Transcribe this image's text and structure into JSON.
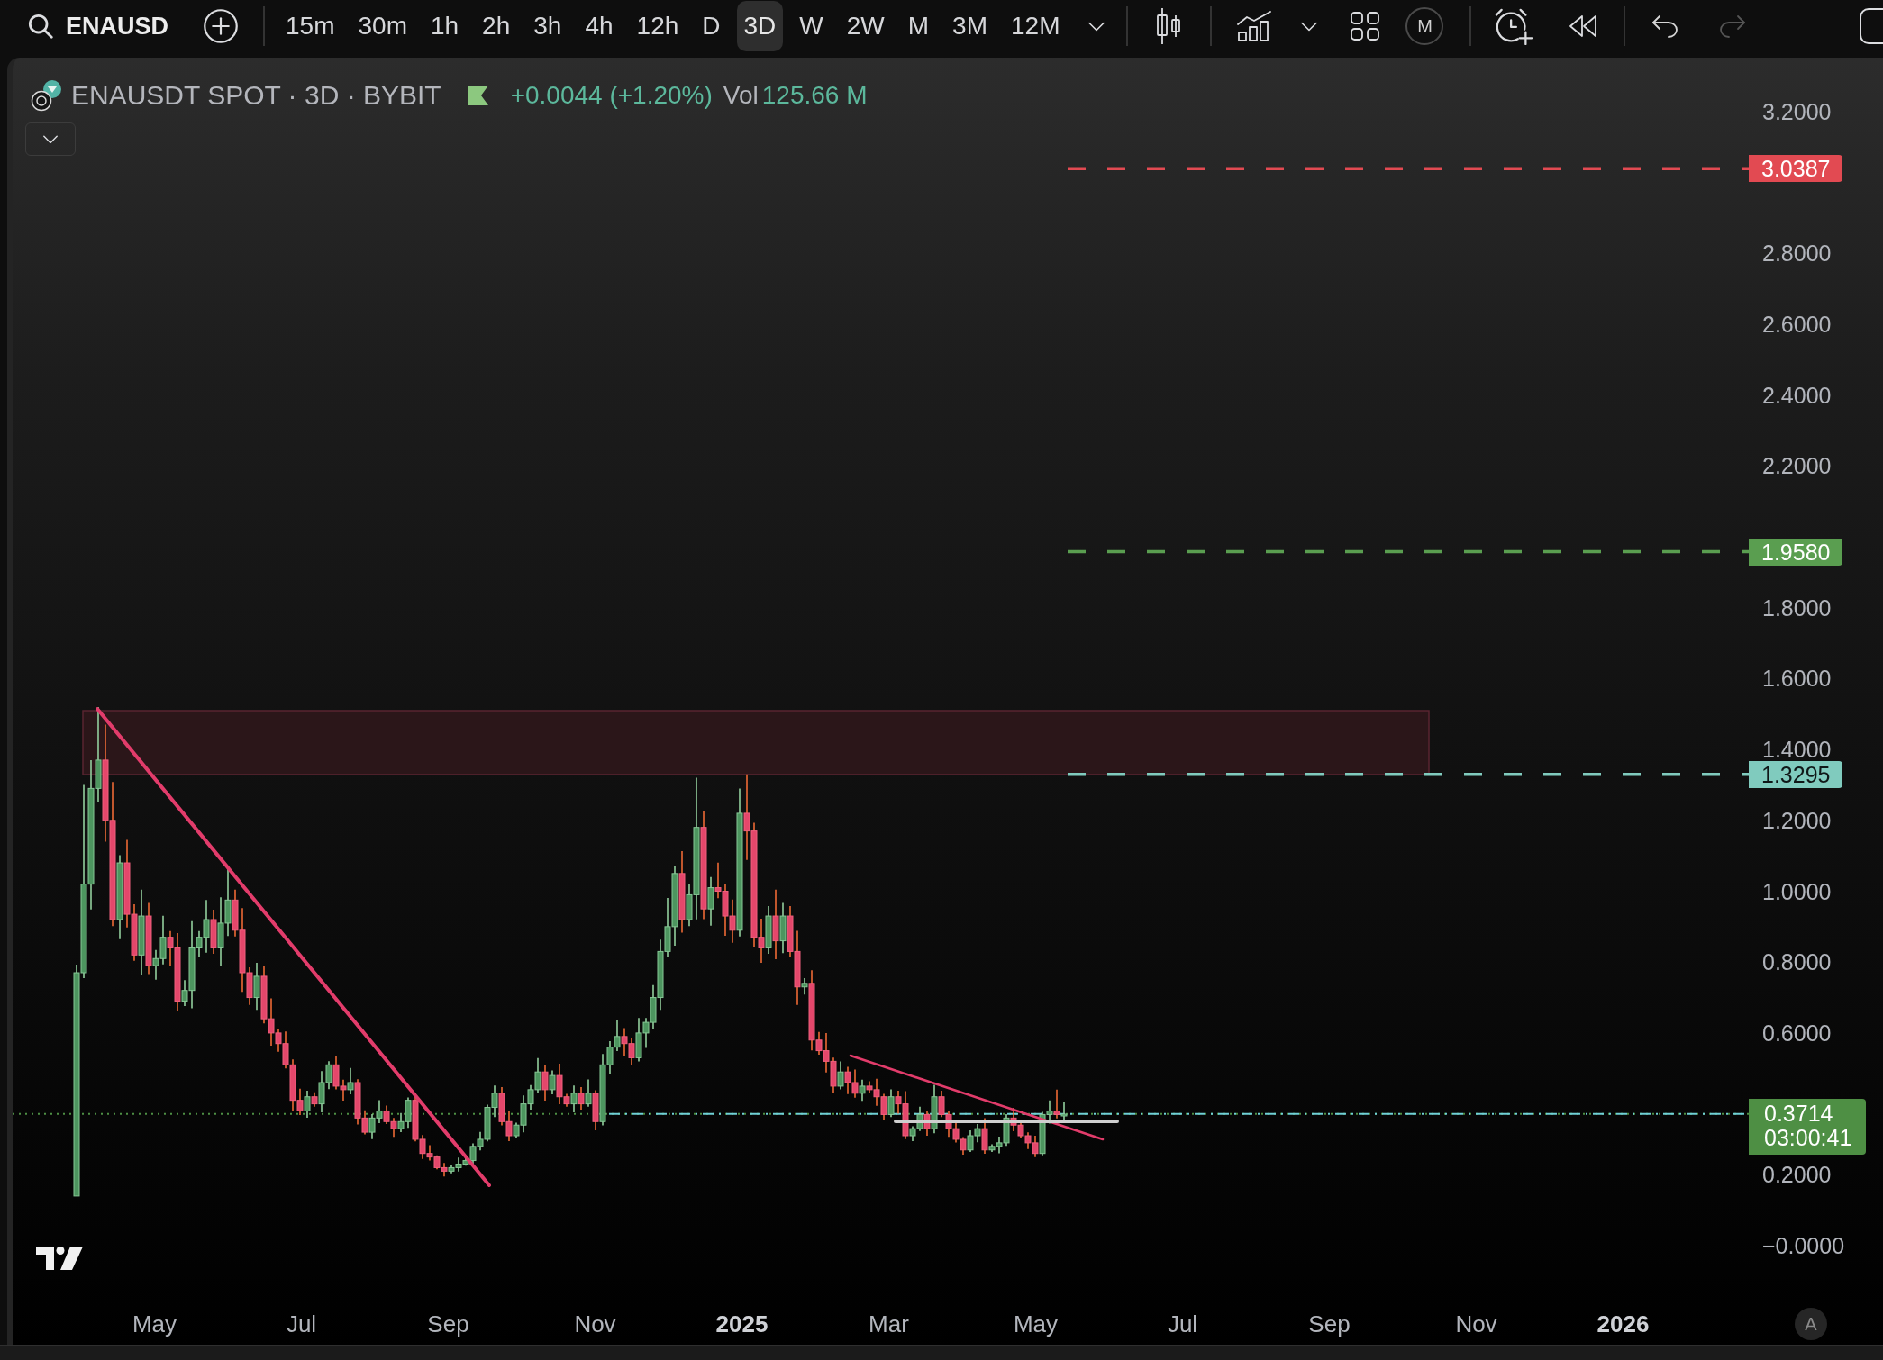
{
  "toolbar": {
    "symbol": "ENAUSD",
    "intervals": [
      {
        "label": "15m",
        "selected": false
      },
      {
        "label": "30m",
        "selected": false
      },
      {
        "label": "1h",
        "selected": false
      },
      {
        "label": "2h",
        "selected": false
      },
      {
        "label": "3h",
        "selected": false
      },
      {
        "label": "4h",
        "selected": false
      },
      {
        "label": "12h",
        "selected": false
      },
      {
        "label": "D",
        "selected": false
      },
      {
        "label": "3D",
        "selected": true
      },
      {
        "label": "W",
        "selected": false
      },
      {
        "label": "2W",
        "selected": false
      },
      {
        "label": "M",
        "selected": false
      },
      {
        "label": "3M",
        "selected": false
      },
      {
        "label": "12M",
        "selected": false
      }
    ],
    "circle_button": "M",
    "history": [
      {
        "kind": "undo",
        "disabled": false
      },
      {
        "kind": "redo",
        "disabled": true
      }
    ]
  },
  "legend": {
    "title": "ENAUSDT SPOT · 3D · BYBIT",
    "change": "+0.0044 (+1.20%)",
    "volume_label": "Vol",
    "volume": "125.66 M"
  },
  "price_axis": {
    "ticks": [
      "3.2000",
      "2.8000",
      "2.6000",
      "2.4000",
      "2.2000",
      "1.8000",
      "1.6000",
      "1.4000",
      "1.2000",
      "1.0000",
      "0.8000",
      "0.6000",
      "0.2000",
      "−0.0000"
    ]
  },
  "price_lines": [
    {
      "kind": "level",
      "price": "3.0387",
      "color": "#e24a52"
    },
    {
      "kind": "level",
      "price": "1.9580",
      "color": "#5a9e50"
    },
    {
      "kind": "level",
      "price": "1.3295",
      "color": "#80cbbe"
    },
    {
      "kind": "last",
      "price": "0.3714",
      "countdown": "03:00:41",
      "color": "#4e8f44"
    }
  ],
  "time_axis": {
    "labels": [
      {
        "text": "May",
        "kind": "month"
      },
      {
        "text": "Jul",
        "kind": "month"
      },
      {
        "text": "Sep",
        "kind": "month"
      },
      {
        "text": "Nov",
        "kind": "month"
      },
      {
        "text": "2025",
        "kind": "year"
      },
      {
        "text": "Mar",
        "kind": "month"
      },
      {
        "text": "May",
        "kind": "month"
      },
      {
        "text": "Jul",
        "kind": "month"
      },
      {
        "text": "Sep",
        "kind": "month"
      },
      {
        "text": "Nov",
        "kind": "month"
      },
      {
        "text": "2026",
        "kind": "year"
      }
    ]
  },
  "scale_button": "A"
}
